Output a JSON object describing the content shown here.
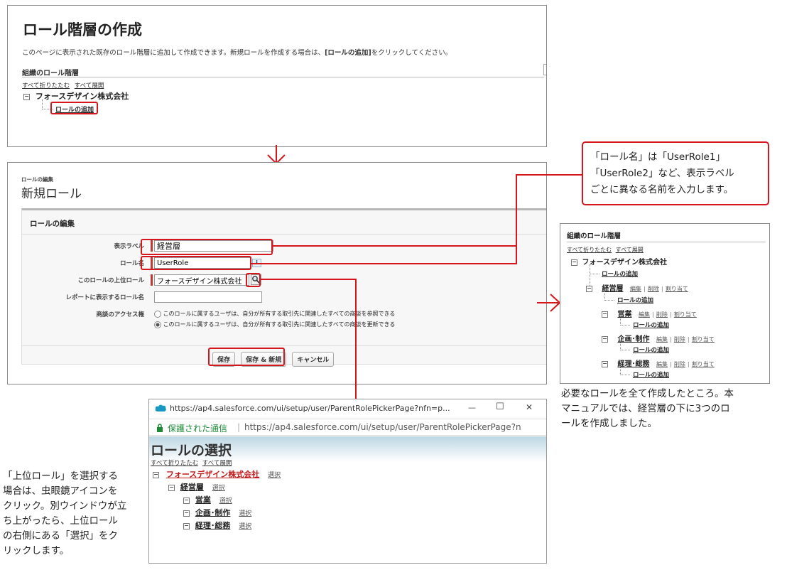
{
  "panel1": {
    "title": "ロール階層の作成",
    "desc_pre": "このページに表示された既存のロール階層に追加して作成できます。新規ロールを作成する場合は、",
    "desc_link": "[ロールの追加]",
    "desc_post": "をクリックしてください。",
    "section": "組織のロール階層",
    "collapse_all": "すべて折りたたむ",
    "expand_all": "すべて展開",
    "company": "フォースデザイン株式会社",
    "add_role": "ロールの追加"
  },
  "panel2": {
    "small_title": "ロールの編集",
    "title": "新規ロール",
    "section": "ロールの編集",
    "label_label": "表示ラベル",
    "label_value": "経営層",
    "name_label": "ロール名",
    "name_value": "UserRole",
    "info_icon": "i",
    "parent_label": "このロールの上位ロール",
    "parent_value": "フォースデザイン株式会社",
    "report_label": "レポートに表示するロール名",
    "report_value": "",
    "access_label": "商談のアクセス権",
    "radio1": "このロールに属するユーザは、自分が所有する取引先に関連したすべての商談を参照できる",
    "radio2": "このロールに属するユーザは、自分が所有する取引先に関連したすべての商談を更新できる",
    "radio_selected": 2,
    "save": "保存",
    "save_new": "保存 & 新規",
    "cancel": "キャンセル"
  },
  "panel3": {
    "section": "組織のロール階層",
    "collapse_all": "すべて折りたたむ",
    "expand_all": "すべて展開",
    "company": "フォースデザイン株式会社",
    "add_role": "ロールの追加",
    "edit": "編集",
    "delete": "削除",
    "assign": "割り当て",
    "role1": "経営層",
    "role2": "営業",
    "role3": "企画･制作",
    "role4": "経理･総務"
  },
  "popup": {
    "tab_url": "https://ap4.salesforce.com/ui/setup/user/ParentRolePickerPage?nfn=p...",
    "minimize": "—",
    "maximize": "☐",
    "close": "✕",
    "secure": "保護された通信",
    "addr_sep": "|",
    "addr_url": "https://ap4.salesforce.com/ui/setup/user/ParentRolePickerPage?n",
    "title": "ロールの選択",
    "collapse_all": "すべて折りたたむ",
    "expand_all": "すべて展開",
    "company": "フォースデザイン株式会社",
    "select": "選択",
    "role1": "経営層",
    "role2": "営業",
    "role3": "企画･制作",
    "role4": "経理･総務"
  },
  "callout": {
    "line1": "「ロール名」は「UserRole1」",
    "line2": "「UserRole2」など、表示ラベル",
    "line3": "ごとに異なる名前を入力します。"
  },
  "caption_right": {
    "line1": "必要なロールを全て作成したところ。本",
    "line2": "マニュアルでは、経営層の下に3つのロ",
    "line3": "ールを作成しました。"
  },
  "caption_left": {
    "line1": "「上位ロール」を選択する",
    "line2": "場合は、虫眼鏡アイコンを",
    "line3": "クリック。別ウインドウが立",
    "line4": "ち上がったら、上位ロール",
    "line5": "の右側にある「選択」をク",
    "line6": "リックします。"
  },
  "colors": {
    "accent_red": "#d5161c",
    "secure_green": "#1a8a35",
    "popup_header": "#cfe3ec"
  }
}
